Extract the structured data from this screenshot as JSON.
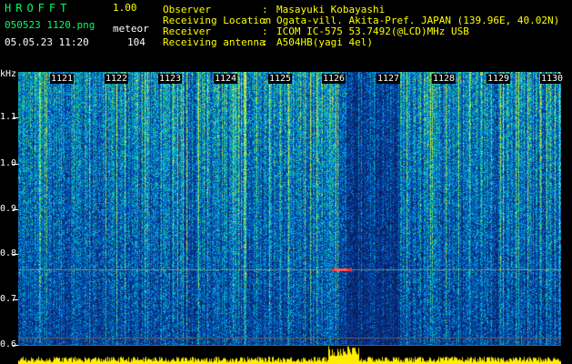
{
  "header": {
    "logo": "HROFFT",
    "version": "1.00",
    "filename": "050523 1120.png",
    "meteor_label": "meteor",
    "datetime": "05.05.23 11:20",
    "meteor_count": "104",
    "info": [
      {
        "label": "Observer",
        "value": "Masayuki Kobayashi"
      },
      {
        "label": "Receiving Location",
        "value": "Ogata-vill. Akita-Pref. JAPAN (139.96E, 40.02N)"
      },
      {
        "label": "Receiver",
        "value": "ICOM IC-575 53.7492(@LCD)MHz USB"
      },
      {
        "label": "Receiving antenna",
        "value": "A504HB(yagi 4el)"
      }
    ]
  },
  "axis": {
    "unit": "kHz",
    "y_ticks": [
      "1.1",
      "1.0",
      "0.9",
      "0.8",
      "0.7",
      "0.6"
    ],
    "time_labels": [
      "1121",
      "1122",
      "1123",
      "1124",
      "1125",
      "1126",
      "1127",
      "1128",
      "1129",
      "1130"
    ]
  },
  "colors": {
    "header_green": "#00ff60",
    "header_yellow": "#ffff00",
    "spectrum_bg": "#0a1a55",
    "meteor_trace": "#ff3030",
    "level_meter": "#ffee00"
  }
}
